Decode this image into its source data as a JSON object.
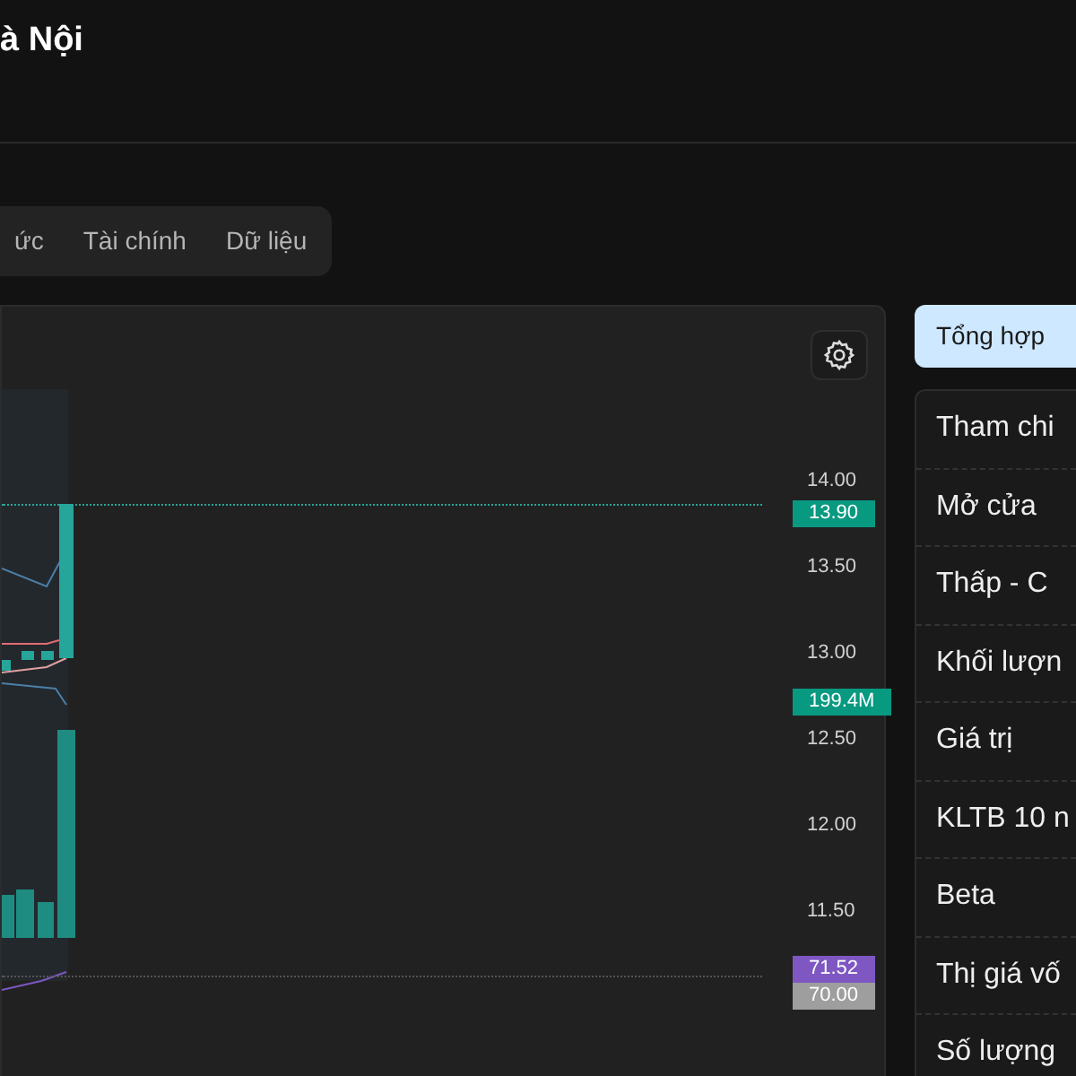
{
  "header": {
    "title": "à Nội"
  },
  "tabs": [
    {
      "label": "ức",
      "selected": false
    },
    {
      "label": "Tài chính",
      "selected": false
    },
    {
      "label": "Dữ liệu",
      "selected": false
    }
  ],
  "chart": {
    "price_axis": [
      "14.00",
      "13.50",
      "13.00",
      "12.50",
      "12.00",
      "11.50"
    ],
    "tags": [
      {
        "text": "13.90",
        "color": "#089981",
        "kind": "price"
      },
      {
        "text": "199.4M",
        "color": "#089981",
        "kind": "volume"
      },
      {
        "text": "71.52",
        "color": "#7e57c2",
        "kind": "rsi"
      },
      {
        "text": "70.00",
        "color": "#9e9e9e",
        "kind": "level"
      }
    ]
  },
  "summary_tab": {
    "label": "Tổng hợp",
    "selected": true
  },
  "stats": [
    {
      "label": "Tham chi"
    },
    {
      "label": "Mở cửa"
    },
    {
      "label": "Thấp - C"
    },
    {
      "label": "Khối lượn"
    },
    {
      "label": "Giá trị"
    },
    {
      "label": "KLTB 10 n"
    },
    {
      "label": "Beta"
    },
    {
      "label": "Thị giá vố"
    },
    {
      "label": "Số lượng"
    }
  ]
}
